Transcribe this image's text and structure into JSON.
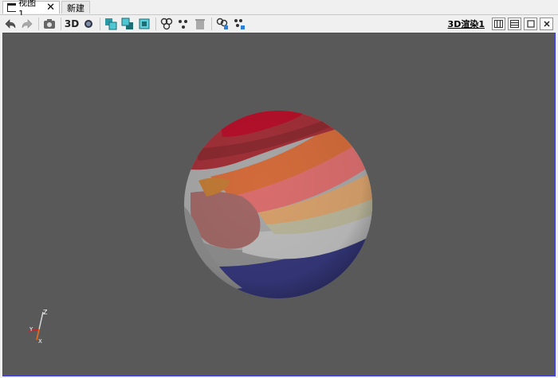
{
  "tabs": [
    {
      "label": "视图 1",
      "active": true
    },
    {
      "label": "新建",
      "active": false
    }
  ],
  "toolbar": {
    "text_3d": "3D",
    "render_label": "3D渲染1"
  },
  "axes": {
    "z_label": "Z",
    "y_label": "Y",
    "x_label": "X"
  },
  "colors": {
    "viewport_bg": "#595959",
    "viewport_border": "#3a3af0",
    "sphere_bottom": "#35377a"
  }
}
